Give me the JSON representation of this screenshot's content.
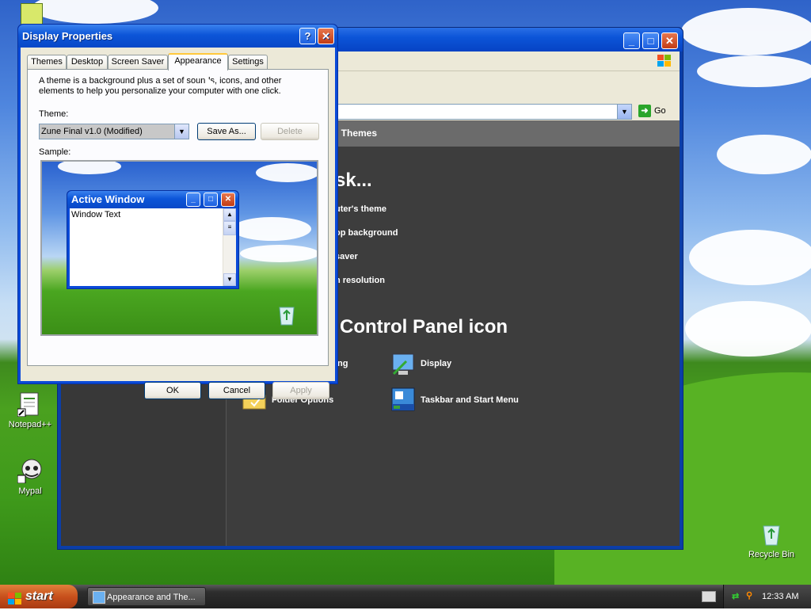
{
  "desktop": {
    "icons": [
      {
        "label": "Notepad++"
      },
      {
        "label": "Mypal"
      },
      {
        "label": "Recycle Bin"
      }
    ]
  },
  "control_panel": {
    "address_go": "Go",
    "header": "...l Themes",
    "header_visible": "l Themes",
    "pick_task_visible": "sk...",
    "tasks": [
      "uter's theme",
      "op background",
      "saver",
      "n resolution"
    ],
    "pick_icon_visible": "Control Panel icon",
    "icons": [
      {
        "label": "ing",
        "icon": "partial-icon"
      },
      {
        "label": "Display",
        "icon": "display-icon"
      },
      {
        "label": "Folder Options",
        "icon": "folder-options-icon"
      },
      {
        "label": "Taskbar and Start Menu",
        "icon": "taskbar-icon"
      }
    ]
  },
  "dialog": {
    "title": "Display Properties",
    "tabs": [
      "Themes",
      "Desktop",
      "Screen Saver",
      "Appearance",
      "Settings"
    ],
    "active_tab": "Appearance",
    "description": "A theme is a background plus a set of sounds, icons, and other elements to help you personalize your computer with one click.",
    "theme_label": "Theme:",
    "theme_value": "Zune Final v1.0 (Modified)",
    "save_as": "Save As...",
    "delete": "Delete",
    "sample_label": "Sample:",
    "sample_window_title": "Active Window",
    "sample_window_text": "Window Text",
    "ok": "OK",
    "cancel": "Cancel",
    "apply": "Apply"
  },
  "taskbar": {
    "start_label": "start",
    "task_button": "Appearance and The...",
    "clock": "12:33 AM"
  },
  "colors": {
    "xp_blue": "#0c55d8",
    "dialog_face": "#ece9d8",
    "panel_dark": "#3d3d3d",
    "start_orange": "#c8501c"
  }
}
